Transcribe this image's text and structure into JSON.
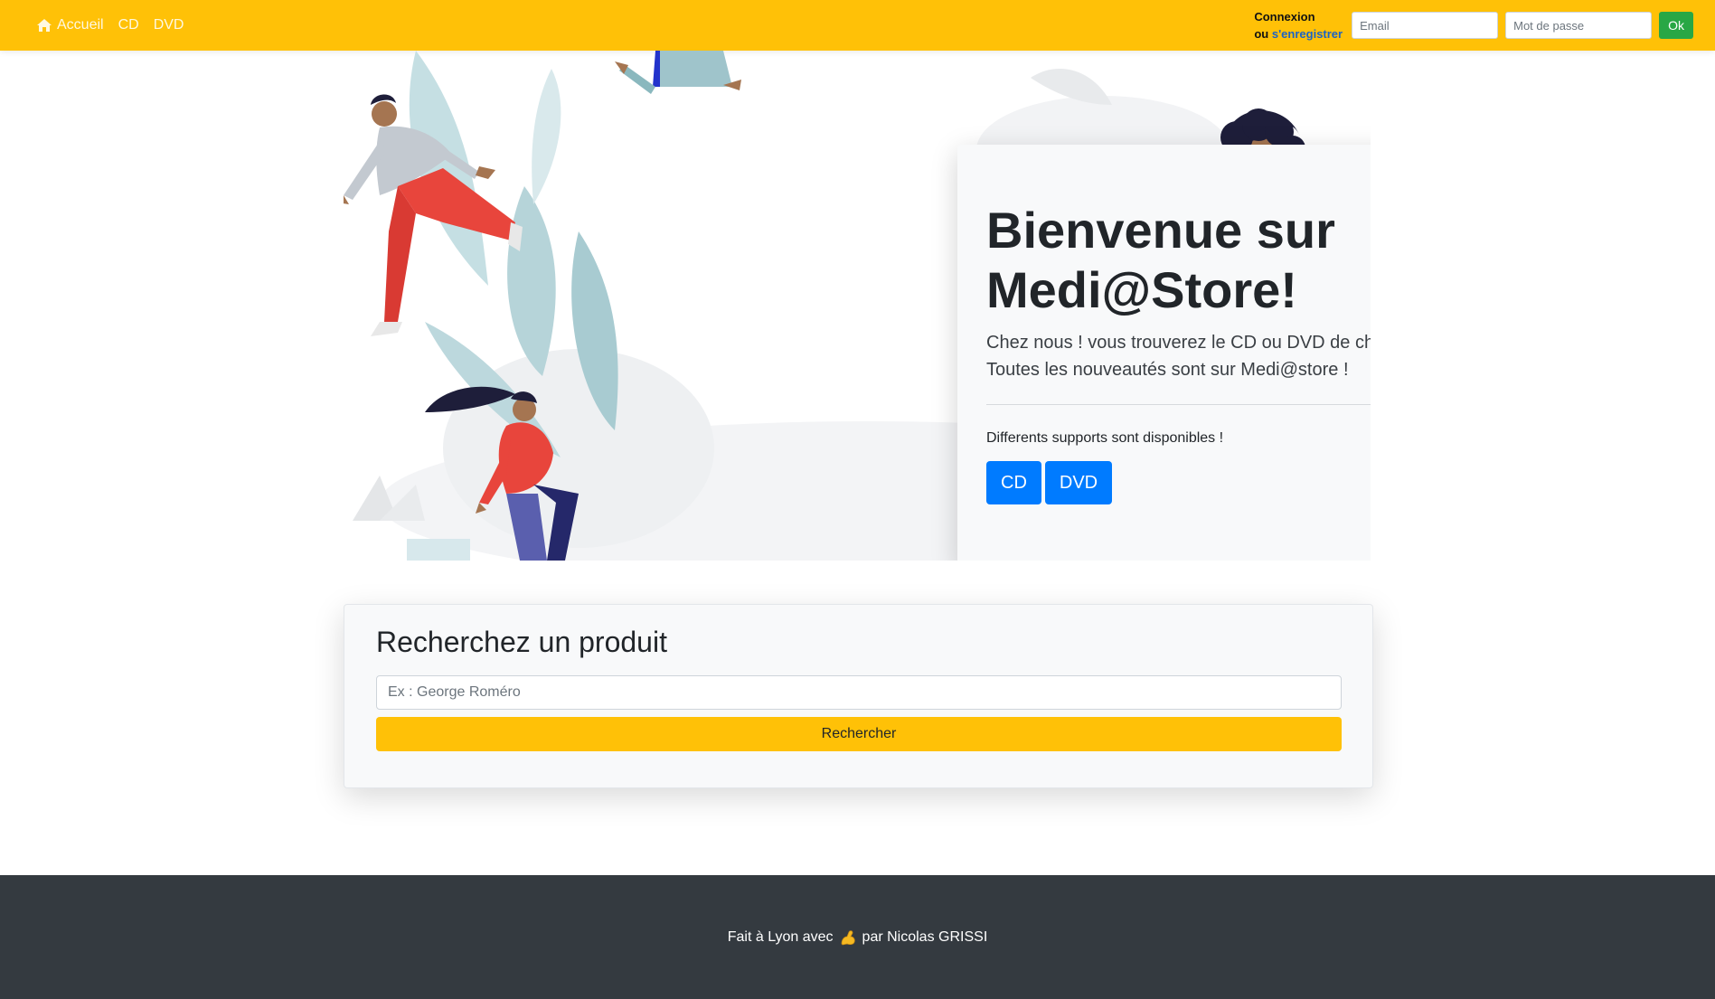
{
  "nav": {
    "home_icon": "home-icon",
    "home_label": "Accueil",
    "cd_label": "CD",
    "dvd_label": "DVD",
    "login_title": "Connexion",
    "login_or": "ou",
    "register_label": "s'enregistrer",
    "email_placeholder": "Email",
    "password_placeholder": "Mot de passe",
    "ok_label": "Ok"
  },
  "hero": {
    "title_line1": "Bienvenue sur",
    "title_line2": "Medi@Store!",
    "lead_line1": "Chez nous ! vous trouverez le CD ou DVD de choix .",
    "lead_line2": "Toutes les nouveautés sont sur Medi@store !",
    "supports_text": "Differents supports sont disponibles !",
    "cd_button": "CD",
    "dvd_button": "DVD"
  },
  "search": {
    "title": "Recherchez un produit",
    "placeholder": "Ex : George Roméro",
    "button_label": "Rechercher"
  },
  "footer": {
    "text_before": "Fait à Lyon avec",
    "icon": "flexed-biceps-icon",
    "text_after": "par Nicolas GRISSI"
  },
  "colors": {
    "navbar": "#ffc107",
    "primary": "#007bff",
    "success": "#28a745",
    "footer": "#343a40",
    "card": "#f8f9fa"
  }
}
